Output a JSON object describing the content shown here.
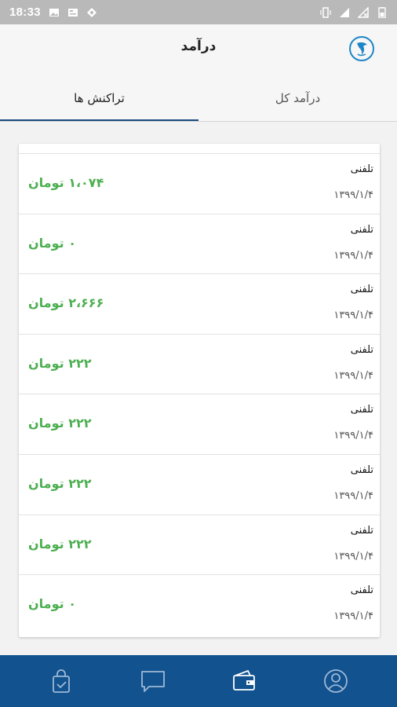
{
  "status_bar": {
    "time": "18:33",
    "left_icons": [
      "image-icon",
      "news-icon",
      "location-icon"
    ],
    "right_icons": [
      "vibrate-icon",
      "signal-icon",
      "no-sim-icon",
      "battery-icon"
    ]
  },
  "header": {
    "title": "درآمد",
    "logo_icon": "app-logo-icon"
  },
  "tabs": [
    {
      "label": "درآمد کل",
      "active": false
    },
    {
      "label": "تراکنش ها",
      "active": true
    }
  ],
  "transactions": [
    {
      "type": "تلفنی",
      "date": "۱۳۹۹/۱/۴",
      "amount": "۱،۰۷۴ تومان"
    },
    {
      "type": "تلفنی",
      "date": "۱۳۹۹/۱/۴",
      "amount": "۰ تومان"
    },
    {
      "type": "تلفنی",
      "date": "۱۳۹۹/۱/۴",
      "amount": "۲،۶۶۶ تومان"
    },
    {
      "type": "تلفنی",
      "date": "۱۳۹۹/۱/۴",
      "amount": "۲۲۲ تومان"
    },
    {
      "type": "تلفنی",
      "date": "۱۳۹۹/۱/۴",
      "amount": "۲۲۲ تومان"
    },
    {
      "type": "تلفنی",
      "date": "۱۳۹۹/۱/۴",
      "amount": "۲۲۲ تومان"
    },
    {
      "type": "تلفنی",
      "date": "۱۳۹۹/۱/۴",
      "amount": "۲۲۲ تومان"
    },
    {
      "type": "تلفنی",
      "date": "۱۳۹۹/۱/۴",
      "amount": "۰ تومان"
    }
  ],
  "bottom_nav": [
    {
      "icon": "shopping-bag-icon",
      "active": false
    },
    {
      "icon": "chat-icon",
      "active": false
    },
    {
      "icon": "wallet-icon",
      "active": true
    },
    {
      "icon": "profile-icon",
      "active": false
    }
  ],
  "colors": {
    "status_bar": "#b9b9b9",
    "app_bar": "#f6f6f6",
    "tab_indicator": "#1a4b7e",
    "amount_green": "#4caf50",
    "bottom_nav": "#11528f",
    "nav_icon_inactive": "#9fb9d6",
    "nav_icon_active": "#ffffff"
  }
}
